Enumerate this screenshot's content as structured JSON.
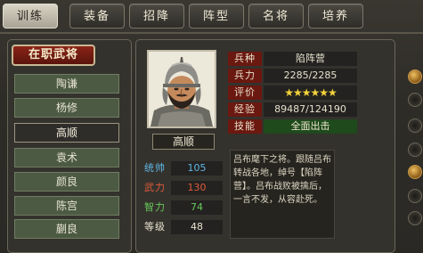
{
  "tabs": [
    {
      "label": "训练",
      "active": true
    },
    {
      "label": "装备",
      "active": false
    },
    {
      "label": "招降",
      "active": false
    },
    {
      "label": "阵型",
      "active": false
    },
    {
      "label": "名将",
      "active": false
    },
    {
      "label": "培养",
      "active": false
    }
  ],
  "left_panel": {
    "title": "在职武将",
    "generals": [
      "陶谦",
      "杨修",
      "高顺",
      "袁术",
      "颜良",
      "陈宫",
      "蒯良"
    ],
    "selected": "高顺"
  },
  "general": {
    "name": "高顺",
    "info": [
      {
        "label": "兵种",
        "value": "陷阵营"
      },
      {
        "label": "兵力",
        "value": "2285/2285"
      },
      {
        "label": "评价",
        "value": "★★★★★★"
      },
      {
        "label": "经验",
        "value": "89487/124190"
      },
      {
        "label": "技能",
        "value": "全面出击"
      }
    ],
    "stats": [
      {
        "label": "统帅",
        "value": "105",
        "color": "#5fb7e6"
      },
      {
        "label": "武力",
        "value": "130",
        "color": "#e05a3a"
      },
      {
        "label": "智力",
        "value": "74",
        "color": "#67c95b"
      },
      {
        "label": "等级",
        "value": "48",
        "color": "#e8e2cf"
      }
    ],
    "description": "吕布麾下之将。跟随吕布转战各地，绰号【陷阵营】。吕布战败被擒后，一言不发，从容赴死。"
  },
  "icons": {
    "portrait": "general-portrait",
    "right_dots": "option-dot-icon"
  }
}
